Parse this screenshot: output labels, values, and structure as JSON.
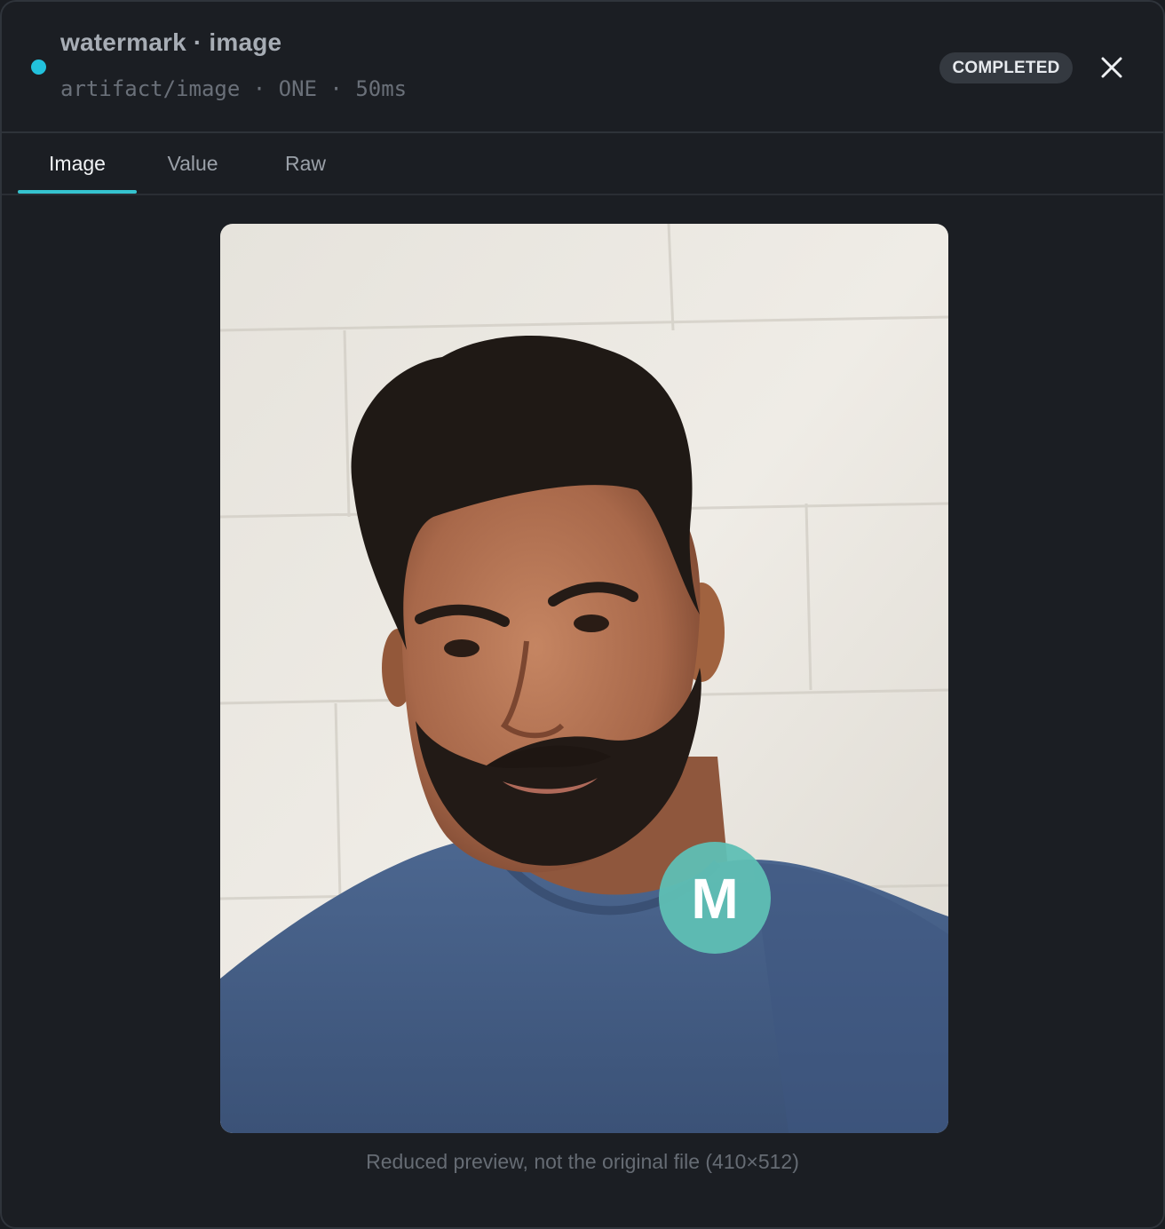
{
  "header": {
    "title": "watermark · image",
    "subtitle": "artifact/image · ONE · 50ms",
    "status_badge": "COMPLETED",
    "status_dot_color": "#22c1dc",
    "close_icon": "close-icon"
  },
  "tabs": [
    {
      "label": "Image",
      "active": true
    },
    {
      "label": "Value",
      "active": false
    },
    {
      "label": "Raw",
      "active": false
    }
  ],
  "preview": {
    "watermark_letter": "M",
    "watermark_color": "#5fbfb4",
    "caption": "Reduced preview, not the original file (410×512)"
  }
}
